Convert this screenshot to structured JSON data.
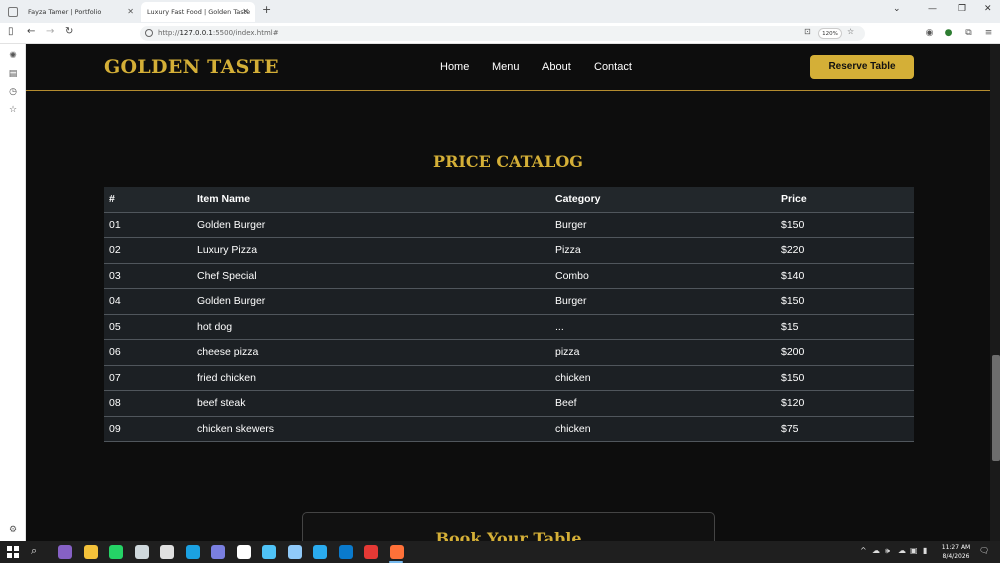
{
  "browser": {
    "tabs": [
      {
        "label": "Fayza Tamer | Portfolio",
        "active": false
      },
      {
        "label": "Luxury Fast Food | Golden Taste",
        "active": true
      }
    ],
    "new_tab": "+",
    "url_scheme": "http://",
    "url_host": "127.0.0.1",
    "url_rest": ":5500/index.html#",
    "zoom": "120%"
  },
  "site": {
    "logo": "GOLDEN TASTE",
    "nav": [
      "Home",
      "Menu",
      "About",
      "Contact"
    ],
    "cta": "Reserve Table",
    "catalog": {
      "title": "PRICE CATALOG",
      "columns": [
        "#",
        "Item Name",
        "Category",
        "Price"
      ],
      "rows": [
        [
          "01",
          "Golden Burger",
          "Burger",
          "$150"
        ],
        [
          "02",
          "Luxury Pizza",
          "Pizza",
          "$220"
        ],
        [
          "03",
          "Chef Special",
          "Combo",
          "$140"
        ],
        [
          "04",
          "Golden Burger",
          "Burger",
          "$150"
        ],
        [
          "05",
          "hot dog",
          "...",
          "$15"
        ],
        [
          "06",
          "cheese pizza",
          "pizza",
          "$200"
        ],
        [
          "07",
          "fried chicken",
          "chicken",
          "$150"
        ],
        [
          "08",
          "beef steak",
          "Beef",
          "$120"
        ],
        [
          "09",
          "chicken skewers",
          "chicken",
          "$75"
        ]
      ]
    },
    "booking_title": "Book Your Table",
    "colors": {
      "gold": "#d4af37",
      "background": "#0d0d0d",
      "table_row": "#1c2024"
    }
  },
  "taskbar": {
    "time": "11:27 AM",
    "date": "8/4/2026",
    "apps": [
      {
        "name": "visual-studio-icon",
        "color": "#8661c5"
      },
      {
        "name": "file-explorer-icon",
        "color": "#f3c13a"
      },
      {
        "name": "whatsapp-icon",
        "color": "#25d366"
      },
      {
        "name": "notepad-icon",
        "color": "#cfd8dc"
      },
      {
        "name": "store-icon",
        "color": "#e0e0e0"
      },
      {
        "name": "edge-icon",
        "color": "#1ba1e2"
      },
      {
        "name": "copilot-icon",
        "color": "#7a7fe0"
      },
      {
        "name": "chatgpt-icon",
        "color": "#ffffff"
      },
      {
        "name": "paint-icon",
        "color": "#4fc3f7"
      },
      {
        "name": "photos-icon",
        "color": "#90caf9"
      },
      {
        "name": "telegram-icon",
        "color": "#2aabee"
      },
      {
        "name": "vscode-icon",
        "color": "#0a7acc"
      },
      {
        "name": "chrome-icon",
        "color": "#e53935"
      },
      {
        "name": "firefox-icon",
        "color": "#ff7139"
      }
    ]
  }
}
